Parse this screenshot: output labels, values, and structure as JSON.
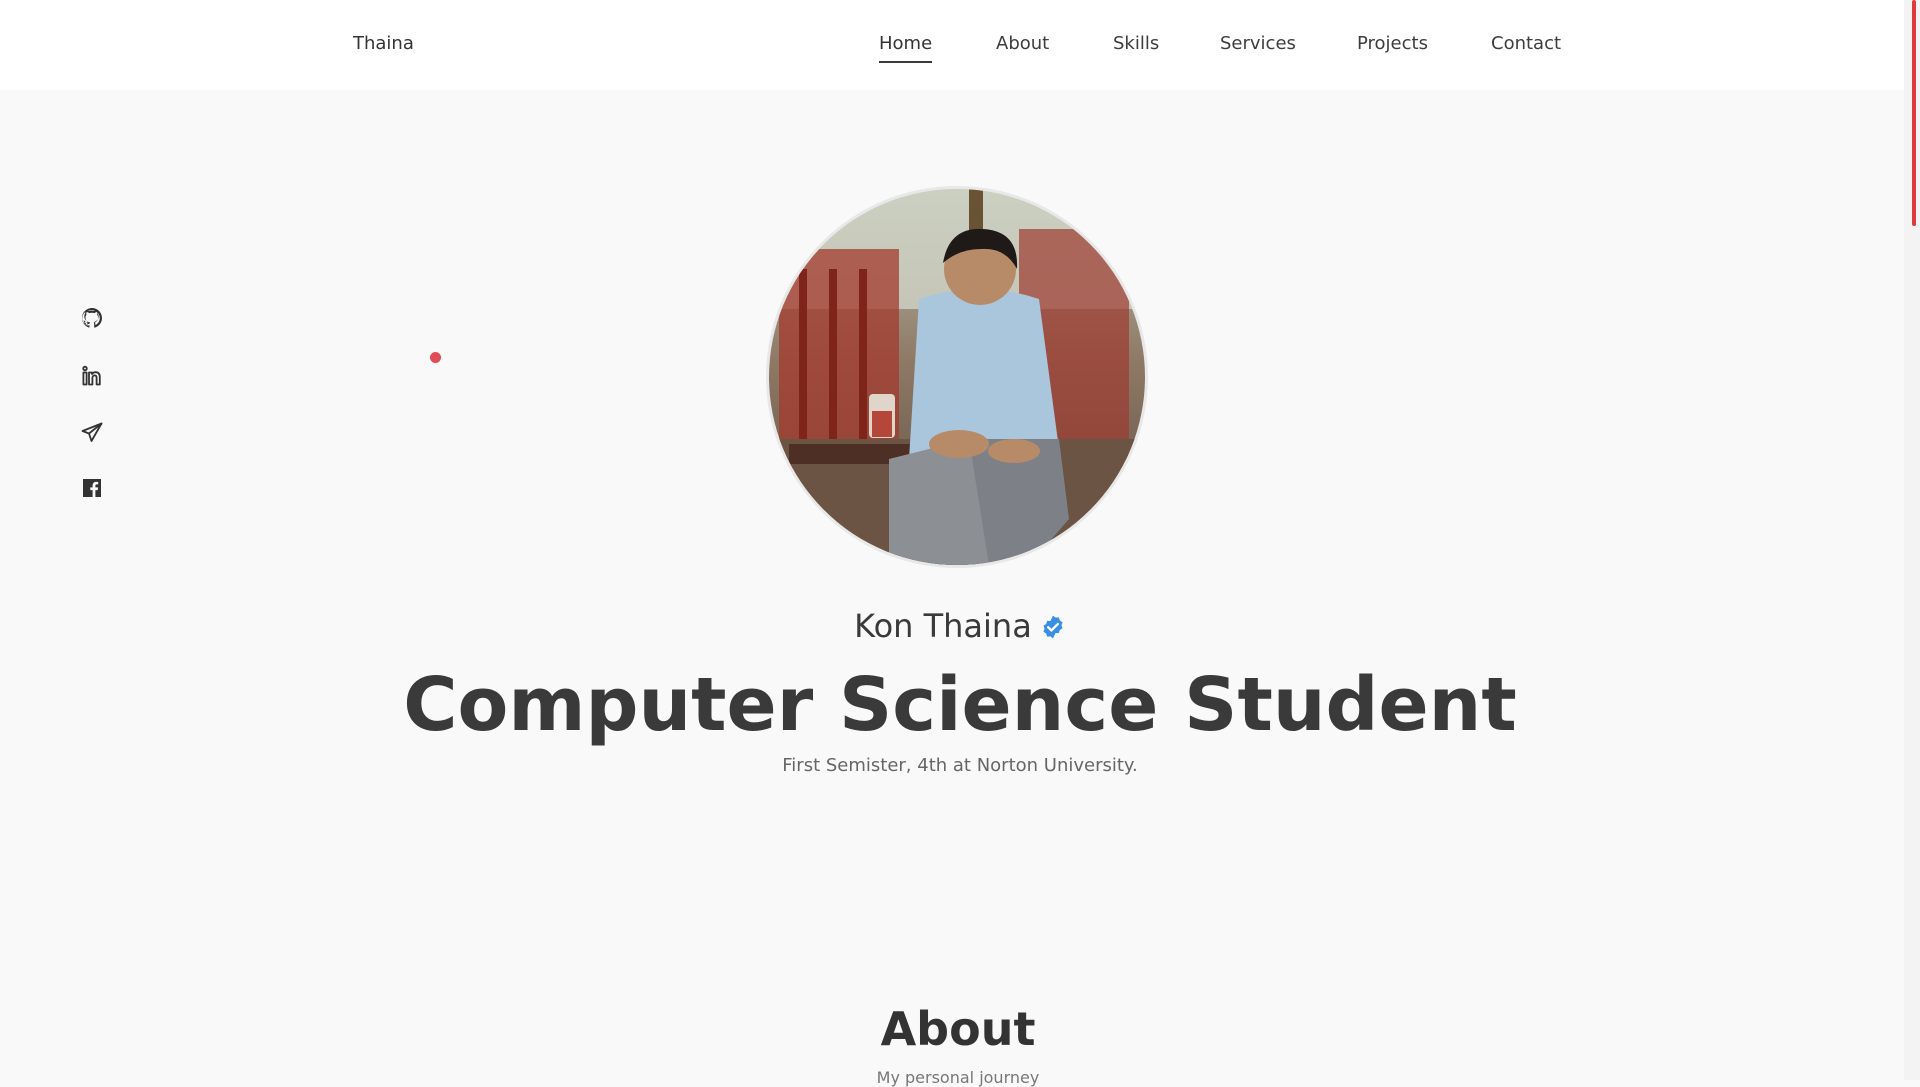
{
  "brand": {
    "logo": "Thaina"
  },
  "nav": {
    "items": [
      {
        "label": "Home",
        "active": true
      },
      {
        "label": "About"
      },
      {
        "label": "Skills"
      },
      {
        "label": "Services"
      },
      {
        "label": "Projects"
      },
      {
        "label": "Contact"
      }
    ]
  },
  "socials": [
    "github-icon",
    "linkedin-icon",
    "telegram-icon",
    "facebook-icon"
  ],
  "hero": {
    "name": "Kon Thaina",
    "title": "Computer Science Student",
    "subtitle": "First Semister, 4th at Norton University."
  },
  "about": {
    "title": "About",
    "subtitle": "My personal journey"
  },
  "colors": {
    "accent": "#e04b55",
    "verified": "#3a8ee6",
    "text": "#3a3a3a",
    "background": "#f9f9f9"
  }
}
